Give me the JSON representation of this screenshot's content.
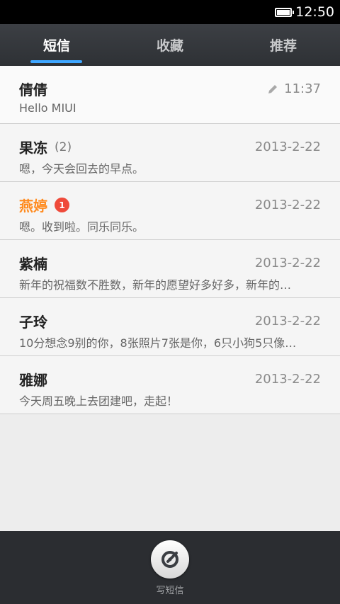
{
  "status": {
    "time": "12:50"
  },
  "tabs": [
    {
      "label": "短信"
    },
    {
      "label": "收藏"
    },
    {
      "label": "推荐"
    }
  ],
  "threads": [
    {
      "name": "倩倩",
      "count": "",
      "badge": "",
      "time": "11:37",
      "preview": "Hello MIUI",
      "draft": true
    },
    {
      "name": "果冻",
      "count": "(2)",
      "badge": "",
      "time": "2013-2-22",
      "preview": "嗯，今天会回去的早点。"
    },
    {
      "name": "燕婷",
      "count": "",
      "badge": "1",
      "time": "2013-2-22",
      "preview": "嗯。收到啦。同乐同乐。"
    },
    {
      "name": "紫楠",
      "count": "",
      "badge": "",
      "time": "2013-2-22",
      "preview": "新年的祝福数不胜数，新年的愿望好多好多，新年的…"
    },
    {
      "name": "子玲",
      "count": "",
      "badge": "",
      "time": "2013-2-22",
      "preview": "10分想念9别的你，8张照片7张是你，6只小狗5只像…"
    },
    {
      "name": "雅娜",
      "count": "",
      "badge": "",
      "time": "2013-2-22",
      "preview": "今天周五晚上去团建吧，走起！"
    }
  ],
  "compose": {
    "label": "写短信"
  },
  "colors": {
    "accent": "#3ea6ff",
    "unread": "#ff8a1e",
    "badge": "#ef4a3a"
  }
}
